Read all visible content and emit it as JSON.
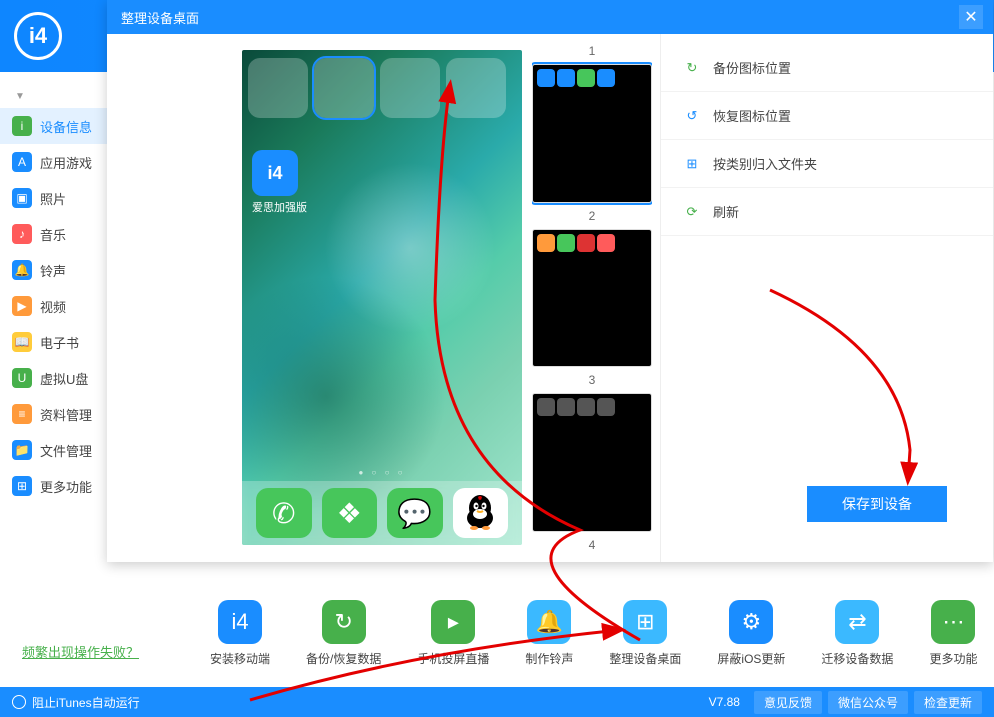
{
  "header": {
    "logo_text": "i4"
  },
  "sidebar": {
    "items": [
      {
        "label": "设备信息",
        "color": "#47b04b",
        "glyph": "i",
        "active": true
      },
      {
        "label": "应用游戏",
        "color": "#1a8dff",
        "glyph": "A"
      },
      {
        "label": "照片",
        "color": "#1a8dff",
        "glyph": "▣"
      },
      {
        "label": "音乐",
        "color": "#ff5b5b",
        "glyph": "♪"
      },
      {
        "label": "铃声",
        "color": "#1a8dff",
        "glyph": "🔔"
      },
      {
        "label": "视频",
        "color": "#ff9a3b",
        "glyph": "▶"
      },
      {
        "label": "电子书",
        "color": "#ffcc3b",
        "glyph": "📖"
      },
      {
        "label": "虚拟U盘",
        "color": "#47b04b",
        "glyph": "U"
      },
      {
        "label": "资料管理",
        "color": "#ff9a3b",
        "glyph": "≡"
      },
      {
        "label": "文件管理",
        "color": "#1a8dff",
        "glyph": "📁"
      },
      {
        "label": "更多功能",
        "color": "#1a8dff",
        "glyph": "⊞"
      }
    ],
    "faq": "频繁出现操作失败？"
  },
  "modal": {
    "title": "整理设备桌面",
    "sub_app_label": "爱思加强版",
    "pages": [
      "1",
      "2",
      "3",
      "4"
    ],
    "right_actions": [
      {
        "label": "备份图标位置",
        "glyph": "↻",
        "color": "#47b04b"
      },
      {
        "label": "恢复图标位置",
        "glyph": "↺",
        "color": "#1a8dff"
      },
      {
        "label": "按类别归入文件夹",
        "glyph": "⊞",
        "color": "#1a8dff"
      },
      {
        "label": "刷新",
        "glyph": "⟳",
        "color": "#47b04b"
      }
    ],
    "save_label": "保存到设备"
  },
  "toolbar": {
    "items": [
      {
        "label": "安装移动端",
        "glyph": "i4",
        "color": "#1a8dff"
      },
      {
        "label": "备份/恢复数据",
        "glyph": "↻",
        "color": "#47b04b"
      },
      {
        "label": "手机投屏直播",
        "glyph": "▸",
        "color": "#47b04b"
      },
      {
        "label": "制作铃声",
        "glyph": "🔔",
        "color": "#3bb9ff"
      },
      {
        "label": "整理设备桌面",
        "glyph": "⊞",
        "color": "#3bb9ff"
      },
      {
        "label": "屏蔽iOS更新",
        "glyph": "⚙",
        "color": "#1a8dff"
      },
      {
        "label": "迁移设备数据",
        "glyph": "⇄",
        "color": "#3bb9ff"
      },
      {
        "label": "更多功能",
        "glyph": "⋯",
        "color": "#47b04b"
      }
    ]
  },
  "footer": {
    "itunes_label": "阻止iTunes自动运行",
    "version": "V7.88",
    "buttons": [
      "意见反馈",
      "微信公众号",
      "检查更新"
    ]
  }
}
